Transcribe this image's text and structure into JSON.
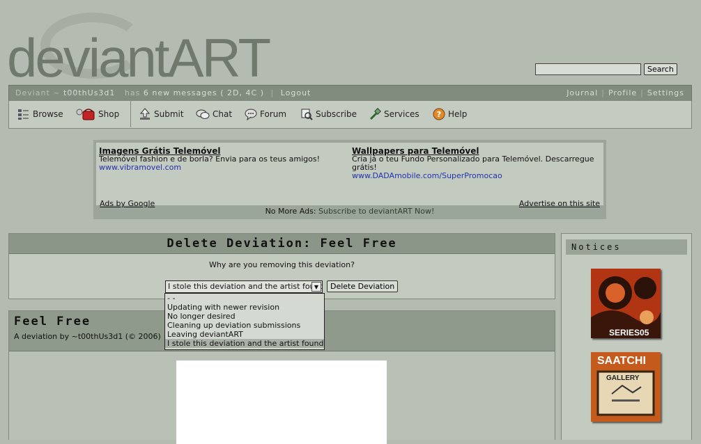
{
  "logo": {
    "text": "deviantART"
  },
  "search": {
    "placeholder": "",
    "button_label": "Search"
  },
  "topbar": {
    "deviant_label": "Deviant ~",
    "username": "t00thUs3d1",
    "has_label": "has",
    "messages": "6 new messages",
    "message_counts": "( 2D, 4C )",
    "logout": "Logout",
    "journal": "Journal",
    "profile": "Profile",
    "settings": "Settings"
  },
  "nav": {
    "browse": "Browse",
    "shop": "Shop",
    "submit": "Submit",
    "chat": "Chat",
    "forum": "Forum",
    "subscribe": "Subscribe",
    "services": "Services",
    "help": "Help"
  },
  "ads": {
    "ad1": {
      "title": "Imagens Grátis Telemóvel",
      "body": "Telemóvel fashion e de borla? Envia para os teus amigos!",
      "url": "www.vibramovel.com"
    },
    "ad2": {
      "title": "Wallpapers para Telemóvel",
      "body": "Cria já o teu Fundo Personalizado para Telemóvel. Descarregue grátis!",
      "url": "www.DADAmobile.com/SuperPromocao"
    },
    "ads_by_google": "Ads by Google",
    "advertise": "Advertise on this site",
    "no_more_ads": "No More Ads:",
    "subscribe_link": "Subscribe to deviantART Now!"
  },
  "delete": {
    "title": "Delete Deviation: Feel Free",
    "question": "Why are you removing this deviation?",
    "selected": "I stole this deviation and the artist found it",
    "button": "Delete Deviation",
    "options": [
      "- -",
      "Updating with newer revision",
      "No longer desired",
      "Cleaning up deviation submissions",
      "Leaving deviantART",
      "I stole this deviation and the artist found it"
    ]
  },
  "deviation": {
    "title": "Feel Free",
    "byline": "A deviation by ~t00thUs3d1 (© 2006)"
  },
  "notices": {
    "title": "Notices",
    "promo1_text": "SERIES05",
    "promo2_text_a": "SAATCHI",
    "promo2_text_b": "GALLERY"
  }
}
